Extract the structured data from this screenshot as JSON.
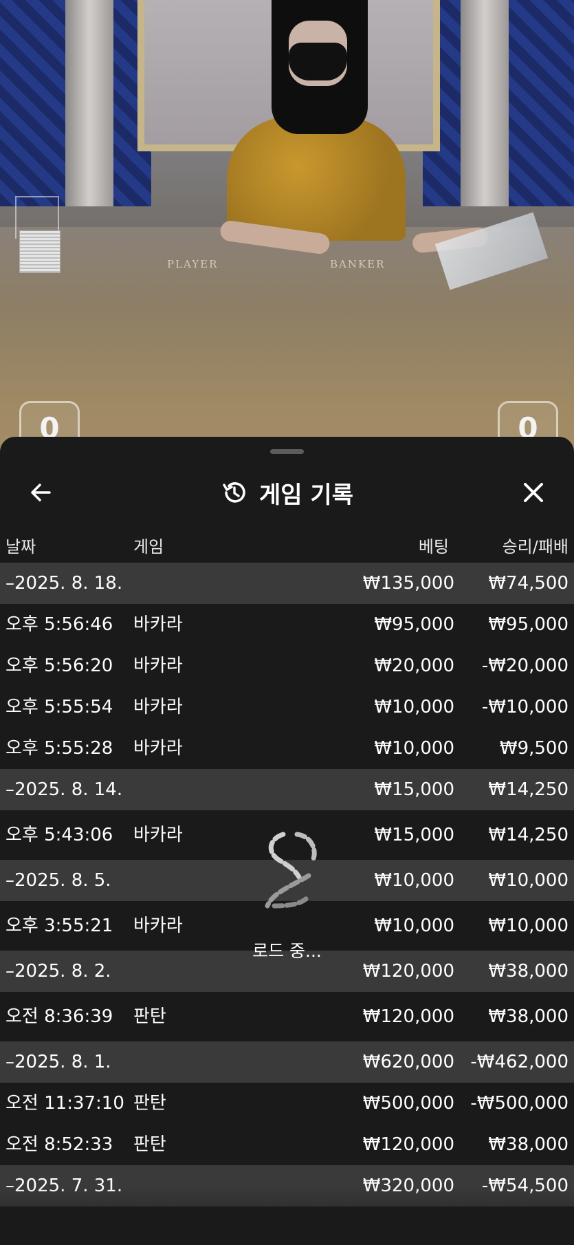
{
  "scene": {
    "table_text_player": "PLAYER",
    "table_text_banker": "BANKER",
    "left_tab_digit": "0",
    "right_tab_digit": "0"
  },
  "sheet": {
    "title": "게임 기록",
    "back_icon": "arrow-left-icon",
    "history_icon": "history-clock-icon",
    "close_icon": "close-x-icon",
    "columns": {
      "date": "날짜",
      "game": "게임",
      "bet": "베팅",
      "winloss": "승리/패배"
    },
    "rows": [
      {
        "type": "group",
        "date": "–2025. 8. 18.",
        "game": "",
        "bet": "₩135,000",
        "winloss": "₩74,500"
      },
      {
        "type": "item",
        "date": "오후 5:56:46",
        "game": "바카라",
        "bet": "₩95,000",
        "winloss": "₩95,000"
      },
      {
        "type": "item",
        "date": "오후 5:56:20",
        "game": "바카라",
        "bet": "₩20,000",
        "winloss": "-₩20,000"
      },
      {
        "type": "item",
        "date": "오후 5:55:54",
        "game": "바카라",
        "bet": "₩10,000",
        "winloss": "-₩10,000"
      },
      {
        "type": "item",
        "date": "오후 5:55:28",
        "game": "바카라",
        "bet": "₩10,000",
        "winloss": "₩9,500"
      },
      {
        "type": "group",
        "date": "–2025. 8. 14.",
        "game": "",
        "bet": "₩15,000",
        "winloss": "₩14,250"
      },
      {
        "type": "item",
        "date": "오후 5:43:06",
        "game": "바카라",
        "bet": "₩15,000",
        "winloss": "₩14,250"
      },
      {
        "type": "group",
        "date": "–2025. 8. 5.",
        "game": "",
        "bet": "₩10,000",
        "winloss": "₩10,000"
      },
      {
        "type": "item",
        "date": "오후 3:55:21",
        "game": "바카라",
        "bet": "₩10,000",
        "winloss": "₩10,000"
      },
      {
        "type": "group",
        "date": "–2025. 8. 2.",
        "game": "",
        "bet": "₩120,000",
        "winloss": "₩38,000"
      },
      {
        "type": "item",
        "date": "오전 8:36:39",
        "game": "판탄",
        "bet": "₩120,000",
        "winloss": "₩38,000"
      },
      {
        "type": "group",
        "date": "–2025. 8. 1.",
        "game": "",
        "bet": "₩620,000",
        "winloss": "-₩462,000"
      },
      {
        "type": "item",
        "date": "오전 11:37:10",
        "game": "판탄",
        "bet": "₩500,000",
        "winloss": "-₩500,000"
      },
      {
        "type": "item",
        "date": "오전 8:52:33",
        "game": "판탄",
        "bet": "₩120,000",
        "winloss": "₩38,000"
      },
      {
        "type": "group",
        "date": "–2025. 7. 31.",
        "game": "",
        "bet": "₩320,000",
        "winloss": "-₩54,500"
      }
    ],
    "loader_text": "로드 중..."
  }
}
